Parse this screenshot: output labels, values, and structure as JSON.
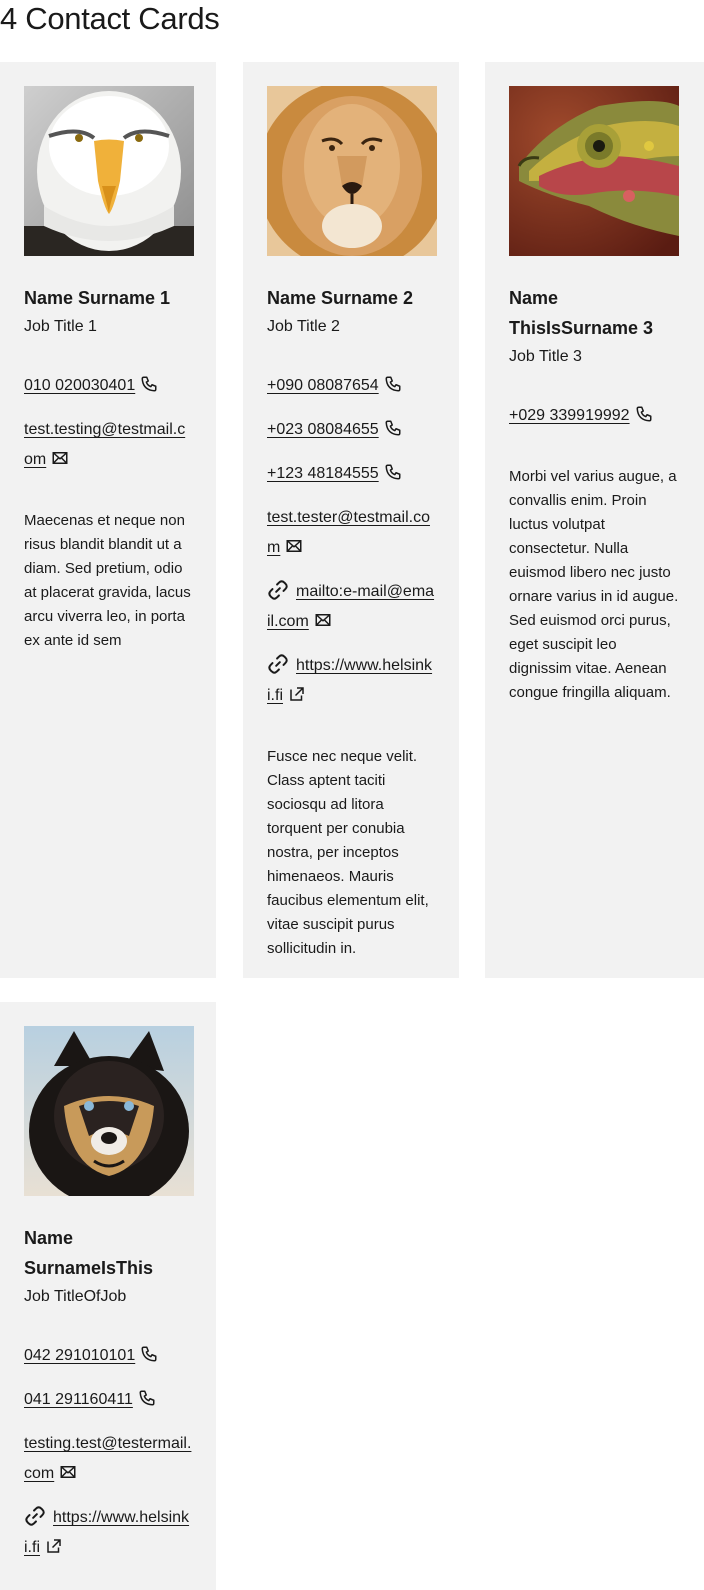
{
  "page": {
    "title": "4 Contact Cards"
  },
  "cards": [
    {
      "name": "Name Surname 1",
      "job_title": "Job Title 1",
      "photo_icon": "eagle-photo",
      "phones": [
        "010 020030401"
      ],
      "email": "test.testing@testmail.com",
      "description": "Maecenas et neque non risus blandit blandit ut a diam. Sed pretium, odio at placerat gravida, lacus arcu viverra leo, in porta ex ante id sem"
    },
    {
      "name": "Name Surname 2",
      "job_title": "Job Title 2",
      "photo_icon": "lion-photo",
      "phones": [
        "+090 08087654",
        "+023 08084655",
        "+123 48184555"
      ],
      "email": "test.tester@testmail.com",
      "mailto_link": "mailto:e-mail@email.com",
      "web_link": "https://www.helsinki.fi",
      "description": "Fusce nec neque velit. Class aptent taciti sociosqu ad litora torquent per conubia nostra, per inceptos himenaeos. Mauris faucibus elementum elit, vitae suscipit purus sollicitudin in."
    },
    {
      "name": "Name ThisIsSurname 3",
      "job_title": "Job Title 3",
      "photo_icon": "chameleon-photo",
      "phones": [
        "+029 339919992"
      ],
      "description": "Morbi vel varius augue, a convallis enim. Proin luctus volutpat consectetur. Nulla euismod libero nec justo ornare varius in id augue. Sed euismod orci purus, eget suscipit leo dignissim vitae. Aenean congue fringilla aliquam."
    },
    {
      "name": "Name SurnameIsThis",
      "job_title": "Job TitleOfJob",
      "photo_icon": "husky-photo",
      "phones": [
        "042 291010101",
        "041 291160411"
      ],
      "email": "testing.test@testermail.com",
      "web_link": "https://www.helsinki.fi"
    }
  ],
  "colors": {
    "card_background": "#f2f2f2",
    "text": "#1a1a1a"
  }
}
